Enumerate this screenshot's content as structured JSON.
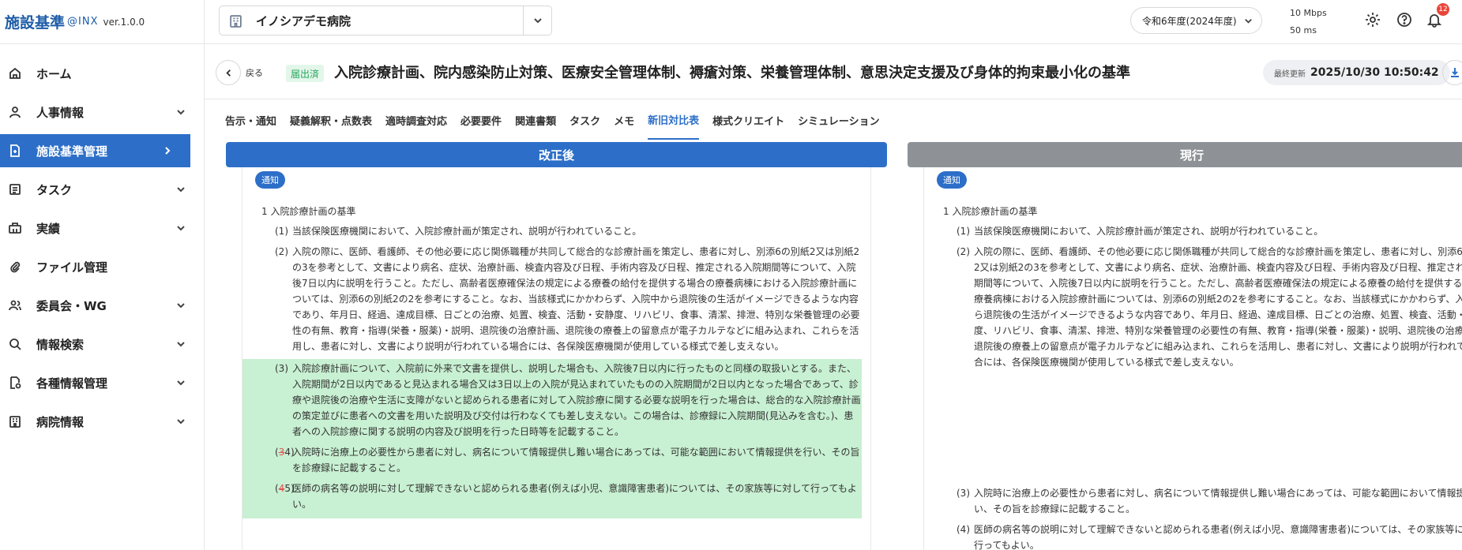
{
  "app": {
    "logo_main": "施設基準",
    "logo_sub": "@INX",
    "version": "ver.1.0.0"
  },
  "sidebar": {
    "items": [
      {
        "label": "ホーム",
        "icon": "home-icon",
        "has_chevron": false
      },
      {
        "label": "人事情報",
        "icon": "user-icon",
        "has_chevron": true
      },
      {
        "label": "施設基準管理",
        "icon": "document-icon",
        "has_chevron": true,
        "active": true
      },
      {
        "label": "タスク",
        "icon": "checklist-icon",
        "has_chevron": true
      },
      {
        "label": "実績",
        "icon": "briefcase-icon",
        "has_chevron": true
      },
      {
        "label": "ファイル管理",
        "icon": "paperclip-icon",
        "has_chevron": false
      },
      {
        "label": "委員会・WG",
        "icon": "users-icon",
        "has_chevron": true
      },
      {
        "label": "情報検索",
        "icon": "search-icon",
        "has_chevron": true
      },
      {
        "label": "各種情報管理",
        "icon": "settings-doc-icon",
        "has_chevron": true
      },
      {
        "label": "病院情報",
        "icon": "hospital-icon",
        "has_chevron": true
      }
    ]
  },
  "header": {
    "hospital_name": "イノシアデモ病院",
    "fiscal_year": "令和6年度(2024年度)",
    "net_speed": "10 Mbps",
    "net_latency": "50 ms",
    "notification_count": "12"
  },
  "titlebar": {
    "back_label": "戻る",
    "status_badge": "届出済",
    "title": "入院診療計画、院内感染防止対策、医療安全管理体制、褥瘡対策、栄養管理体制、意思決定支援及び身体的拘束最小化の基準",
    "updated_label": "最終更新",
    "updated_value": "2025/10/30 10:50:42"
  },
  "tabs": [
    "告示・通知",
    "疑義解釈・点数表",
    "適時調査対応",
    "必要要件",
    "関連書類",
    "タスク",
    "メモ",
    "新旧対比表",
    "様式クリエイト",
    "シミュレーション"
  ],
  "active_tab": "新旧対比表",
  "compare": {
    "new_header": "改正後",
    "old_header": "現行",
    "notice_badge": "通知",
    "heading": "1 入院診療計画の基準",
    "item1_num": "(1)",
    "item1": "当該保険医療機関において、入院診療計画が策定され、説明が行われていること。",
    "item2_num": "(2)",
    "item2": "入院の際に、医師、看護師、その他必要に応じ関係職種が共同して総合的な診療計画を策定し、患者に対し、別添6の別紙2又は別紙2の3を参考として、文書により病名、症状、治療計画、検査内容及び日程、手術内容及び日程、推定される入院期間等について、入院後7日以内に説明を行うこと。ただし、高齢者医療確保法の規定による療養の給付を提供する場合の療養病棟における入院診療計画については、別添6の別紙2の2を参考にすること。なお、当該様式にかかわらず、入院中から退院後の生活がイメージできるような内容であり、年月日、経過、達成目標、日ごとの治療、処置、検査、活動・安静度、リハビリ、食事、清潔、排泄、特別な栄養管理の必要性の有無、教育・指導(栄養・服薬)・説明、退院後の治療計画、退院後の療養上の留意点が電子カルテなどに組み込まれ、これらを活用し、患者に対し、文書により説明が行われている場合には、各保険医療機関が使用している様式で差し支えない。",
    "item3_num": "(3)",
    "item3_added": "入院診療計画について、入院前に外来で文書を提供し、説明した場合も、入院後7日以内に行ったものと同様の取扱いとする。また、入院期間が2日以内であると見込まれる場合又は3日以上の入院が見込まれていたものの入院期間が2日以内となった場合であって、診療や退院後の治療や生活に支障がないと認められる患者に対して入院診療に関する必要な説明を行った場合は、総合的な入院診療計画の策定並びに患者への文書を用いた説明及び交付は行わなくても差し支えない。この場合は、診療録に入院期間(見込みを含む。)、患者への入院診療に関する説明の内容及び説明を行った日時等を記載すること。",
    "item4_num_old": "3",
    "item4_num_new": "4",
    "item4": "入院時に治療上の必要性から患者に対し、病名について情報提供し難い場合にあっては、可能な範囲において情報提供を行い、その旨を診療録に記載すること。",
    "item5_num_old": "4",
    "item5_num_new": "5",
    "item5": "医師の病名等の説明に対して理解できないと認められる患者(例えば小児、意識障害患者)については、その家族等に対して行ってもよい。",
    "old_item3_num": "(3)",
    "old_item4_num": "(4)"
  }
}
